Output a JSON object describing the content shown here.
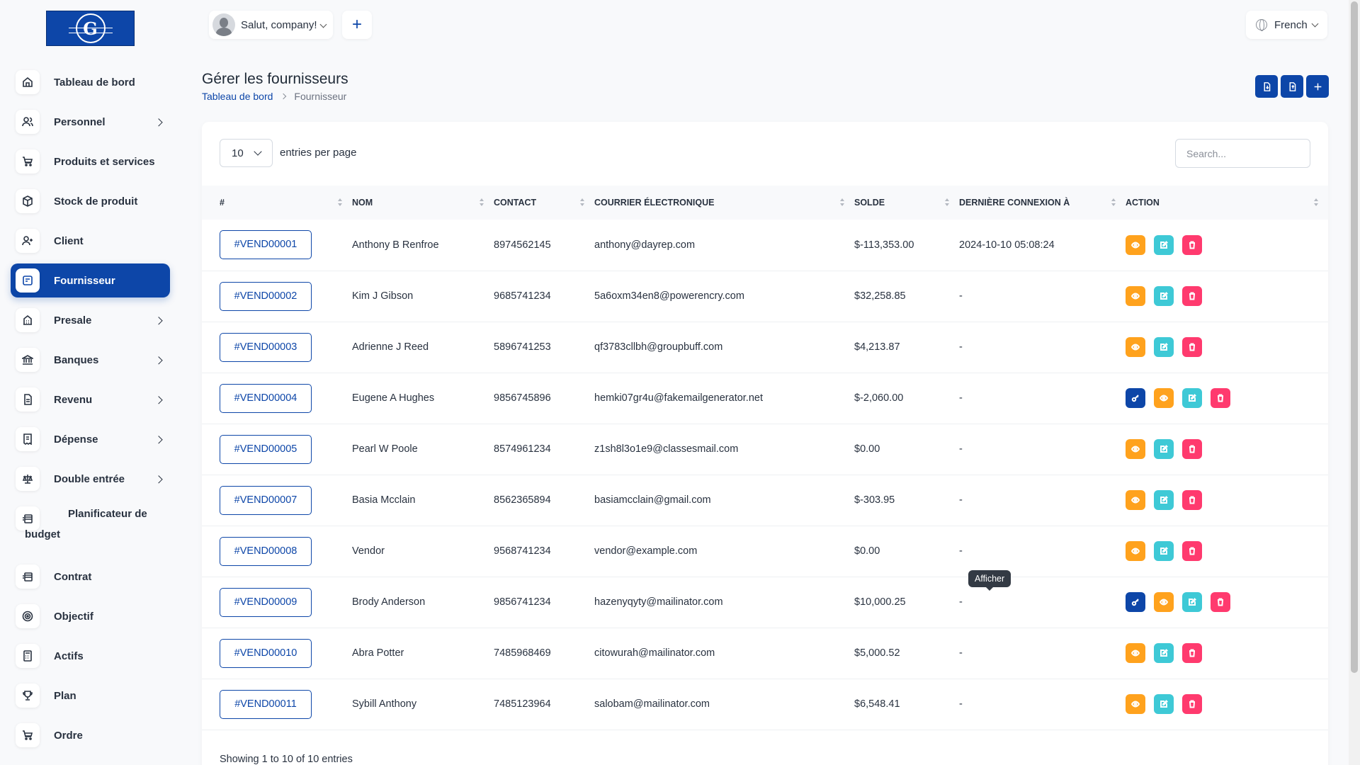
{
  "sidebar": {
    "items": [
      {
        "label": "Tableau de bord",
        "icon": "home-icon",
        "arrow": false,
        "active": false
      },
      {
        "label": "Personnel",
        "icon": "users-icon",
        "arrow": true,
        "active": false
      },
      {
        "label": "Produits et services",
        "icon": "cart-icon",
        "arrow": false,
        "active": false
      },
      {
        "label": "Stock de produit",
        "icon": "box-icon",
        "arrow": false,
        "active": false
      },
      {
        "label": "Client",
        "icon": "user-plus-icon",
        "arrow": false,
        "active": false
      },
      {
        "label": "Fournisseur",
        "icon": "note-icon",
        "arrow": false,
        "active": true
      },
      {
        "label": "Presale",
        "icon": "building-icon",
        "arrow": true,
        "active": false
      },
      {
        "label": "Banques",
        "icon": "bank-icon",
        "arrow": true,
        "active": false
      },
      {
        "label": "Revenu",
        "icon": "file-invoice-icon",
        "arrow": true,
        "active": false
      },
      {
        "label": "Dépense",
        "icon": "receipt-icon",
        "arrow": true,
        "active": false
      },
      {
        "label": "Double entrée",
        "icon": "scale-icon",
        "arrow": true,
        "active": false
      },
      {
        "label": "Planificateur de",
        "label2": "budget",
        "icon": "money-icon",
        "arrow": false,
        "active": false
      },
      {
        "label": "Contrat",
        "icon": "contract-money-icon",
        "arrow": false,
        "active": false
      },
      {
        "label": "Objectif",
        "icon": "target-icon",
        "arrow": false,
        "active": false
      },
      {
        "label": "Actifs",
        "icon": "calculator-icon",
        "arrow": false,
        "active": false
      },
      {
        "label": "Plan",
        "icon": "trophy-icon",
        "arrow": false,
        "active": false
      },
      {
        "label": "Ordre",
        "icon": "cart-order-icon",
        "arrow": false,
        "active": false
      }
    ]
  },
  "header": {
    "greeting": "Salut, company!",
    "language": "French"
  },
  "page": {
    "title": "Gérer les fournisseurs",
    "breadcrumb_home": "Tableau de bord",
    "breadcrumb_current": "Fournisseur"
  },
  "table_controls": {
    "per_page_value": "10",
    "per_page_label": "entries per page",
    "search_placeholder": "Search..."
  },
  "table": {
    "columns": [
      "#",
      "NOM",
      "CONTACT",
      "COURRIER ÉLECTRONIQUE",
      "SOLDE",
      "DERNIÈRE CONNEXION À",
      "ACTION"
    ],
    "rows": [
      {
        "id": "#VEND00001",
        "name": "Anthony B Renfroe",
        "contact": "8974562145",
        "email": "anthony@dayrep.com",
        "balance": "$-113,353.00",
        "last_login": "2024-10-10 05:08:24",
        "has_key": false
      },
      {
        "id": "#VEND00002",
        "name": "Kim J Gibson",
        "contact": "9685741234",
        "email": "5a6oxm34en8@powerencry.com",
        "balance": "$32,258.85",
        "last_login": "-",
        "has_key": false
      },
      {
        "id": "#VEND00003",
        "name": "Adrienne J Reed",
        "contact": "5896741253",
        "email": "qf3783cllbh@groupbuff.com",
        "balance": "$4,213.87",
        "last_login": "-",
        "has_key": false
      },
      {
        "id": "#VEND00004",
        "name": "Eugene A Hughes",
        "contact": "9856745896",
        "email": "hemki07gr4u@fakemailgenerator.net",
        "balance": "$-2,060.00",
        "last_login": "-",
        "has_key": true
      },
      {
        "id": "#VEND00005",
        "name": "Pearl W Poole",
        "contact": "8574961234",
        "email": "z1sh8l3o1e9@classesmail.com",
        "balance": "$0.00",
        "last_login": "-",
        "has_key": false
      },
      {
        "id": "#VEND00007",
        "name": "Basia Mcclain",
        "contact": "8562365894",
        "email": "basiamcclain@gmail.com",
        "balance": "$-303.95",
        "last_login": "-",
        "has_key": false
      },
      {
        "id": "#VEND00008",
        "name": "Vendor",
        "contact": "9568741234",
        "email": "vendor@example.com",
        "balance": "$0.00",
        "last_login": "-",
        "has_key": false
      },
      {
        "id": "#VEND00009",
        "name": "Brody Anderson",
        "contact": "9856741234",
        "email": "hazenyqyty@mailinator.com",
        "balance": "$10,000.25",
        "last_login": "-",
        "has_key": true
      },
      {
        "id": "#VEND00010",
        "name": "Abra Potter",
        "contact": "7485968469",
        "email": "citowurah@mailinator.com",
        "balance": "$5,000.52",
        "last_login": "-",
        "has_key": false
      },
      {
        "id": "#VEND00011",
        "name": "Sybill Anthony",
        "contact": "7485123964",
        "email": "salobam@mailinator.com",
        "balance": "$6,548.41",
        "last_login": "-",
        "has_key": false
      }
    ]
  },
  "tooltip": "Afficher",
  "footer": {
    "showing": "Showing 1 to 10 of 10 entries"
  },
  "colors": {
    "primary": "#0d46a8",
    "view": "#ffa21d",
    "edit": "#3ec9d6",
    "delete": "#ff3a6e"
  }
}
